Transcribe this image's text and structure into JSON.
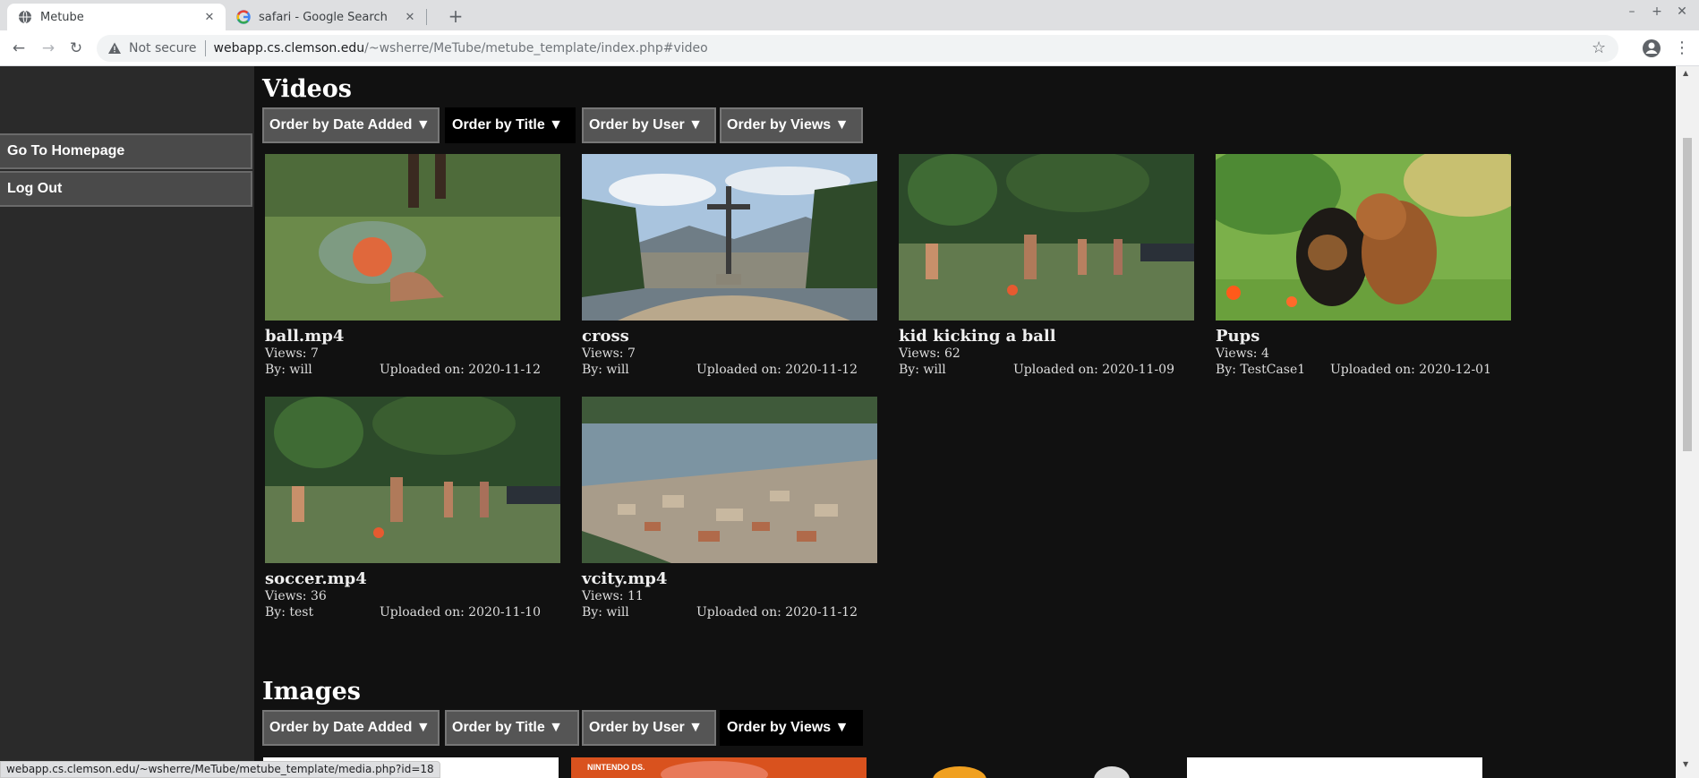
{
  "browser": {
    "tabs": [
      {
        "title": "Metube",
        "active": true
      },
      {
        "title": "safari - Google Search",
        "active": false
      }
    ],
    "security_label": "Not secure",
    "url_host": "webapp.cs.clemson.edu",
    "url_path": "/~wsherre/MeTube/metube_template/index.php#video",
    "status_url": "webapp.cs.clemson.edu/~wsherre/MeTube/metube_template/media.php?id=18"
  },
  "sidebar": {
    "items": [
      {
        "label": "Go To Homepage"
      },
      {
        "label": "Log Out"
      }
    ]
  },
  "videos": {
    "title": "Videos",
    "sort_buttons": [
      {
        "label": "Order by Date Added ▼",
        "active": false
      },
      {
        "label": "Order by Title ▼",
        "active": true
      },
      {
        "label": "Order by User ▼",
        "active": false
      },
      {
        "label": "Order by Views ▼",
        "active": false
      }
    ],
    "items": [
      {
        "name": "ball.mp4",
        "views": "Views: 7",
        "by": "By: will",
        "uploaded": "Uploaded on: 2020-11-12",
        "thumb": "ball"
      },
      {
        "name": "cross",
        "views": "Views: 7",
        "by": "By: will",
        "uploaded": "Uploaded on: 2020-11-12",
        "thumb": "cross"
      },
      {
        "name": "kid kicking a ball",
        "views": "Views: 62",
        "by": "By: will",
        "uploaded": "Uploaded on: 2020-11-09",
        "thumb": "soccer"
      },
      {
        "name": "Pups",
        "views": "Views: 4",
        "by": "By: TestCase1",
        "uploaded": "Uploaded on: 2020-12-01",
        "thumb": "pups"
      },
      {
        "name": "soccer.mp4",
        "views": "Views: 36",
        "by": "By: test",
        "uploaded": "Uploaded on: 2020-11-10",
        "thumb": "soccer"
      },
      {
        "name": "vcity.mp4",
        "views": "Views: 11",
        "by": "By: will",
        "uploaded": "Uploaded on: 2020-11-12",
        "thumb": "city"
      }
    ]
  },
  "images": {
    "title": "Images",
    "sort_buttons": [
      {
        "label": "Order by Date Added ▼",
        "active": false
      },
      {
        "label": "Order by Title ▼",
        "active": false
      },
      {
        "label": "Order by User ▼",
        "active": false
      },
      {
        "label": "Order by Views ▼",
        "active": true
      }
    ],
    "peek_labels": [
      "NINTENDO DS."
    ]
  },
  "colors": {
    "page_bg": "#111111",
    "sidebar_bg": "#2a2a2a",
    "button_bg": "#555555",
    "button_active_bg": "#000000"
  }
}
